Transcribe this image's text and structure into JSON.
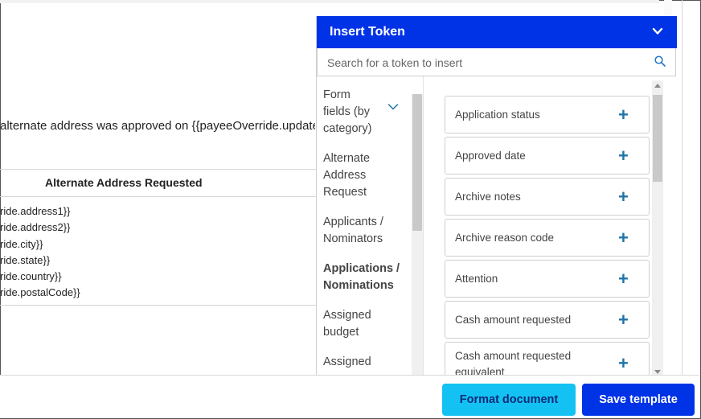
{
  "editor": {
    "sentence": "alternate address was approved on {{payeeOverride.updatedDate}}",
    "table_header": "Alternate Address Requested",
    "table_rows": [
      "ride.address1}}",
      "ride.address2}}",
      "ride.city}}",
      "ride.state}}",
      "ride.country}}",
      "ride.postalCode}}"
    ]
  },
  "panel": {
    "title": "Insert Token",
    "search_placeholder": "Search for a token to insert",
    "categories": [
      "Form fields (by category)",
      "Alternate Address Request",
      "Applicants / Nominators",
      "Applications / Nominations",
      "Assigned budget",
      "Assigned"
    ],
    "tokens": [
      "Application status",
      "Approved date",
      "Archive notes",
      "Archive reason code",
      "Attention",
      "Cash amount requested",
      "Cash amount requested equivalent"
    ],
    "add_symbol": "+"
  },
  "footer": {
    "format_label": "Format document",
    "save_label": "Save template"
  },
  "colors": {
    "header_bg": "#0033e6",
    "format_button_bg": "#13c2f2",
    "save_button_bg": "#0033e6",
    "plus_color": "#1f74a8"
  },
  "icons": {
    "collapse": "chevron-down-icon",
    "search": "search-icon",
    "expand_category": "chevron-down-icon",
    "add": "plus-icon"
  }
}
